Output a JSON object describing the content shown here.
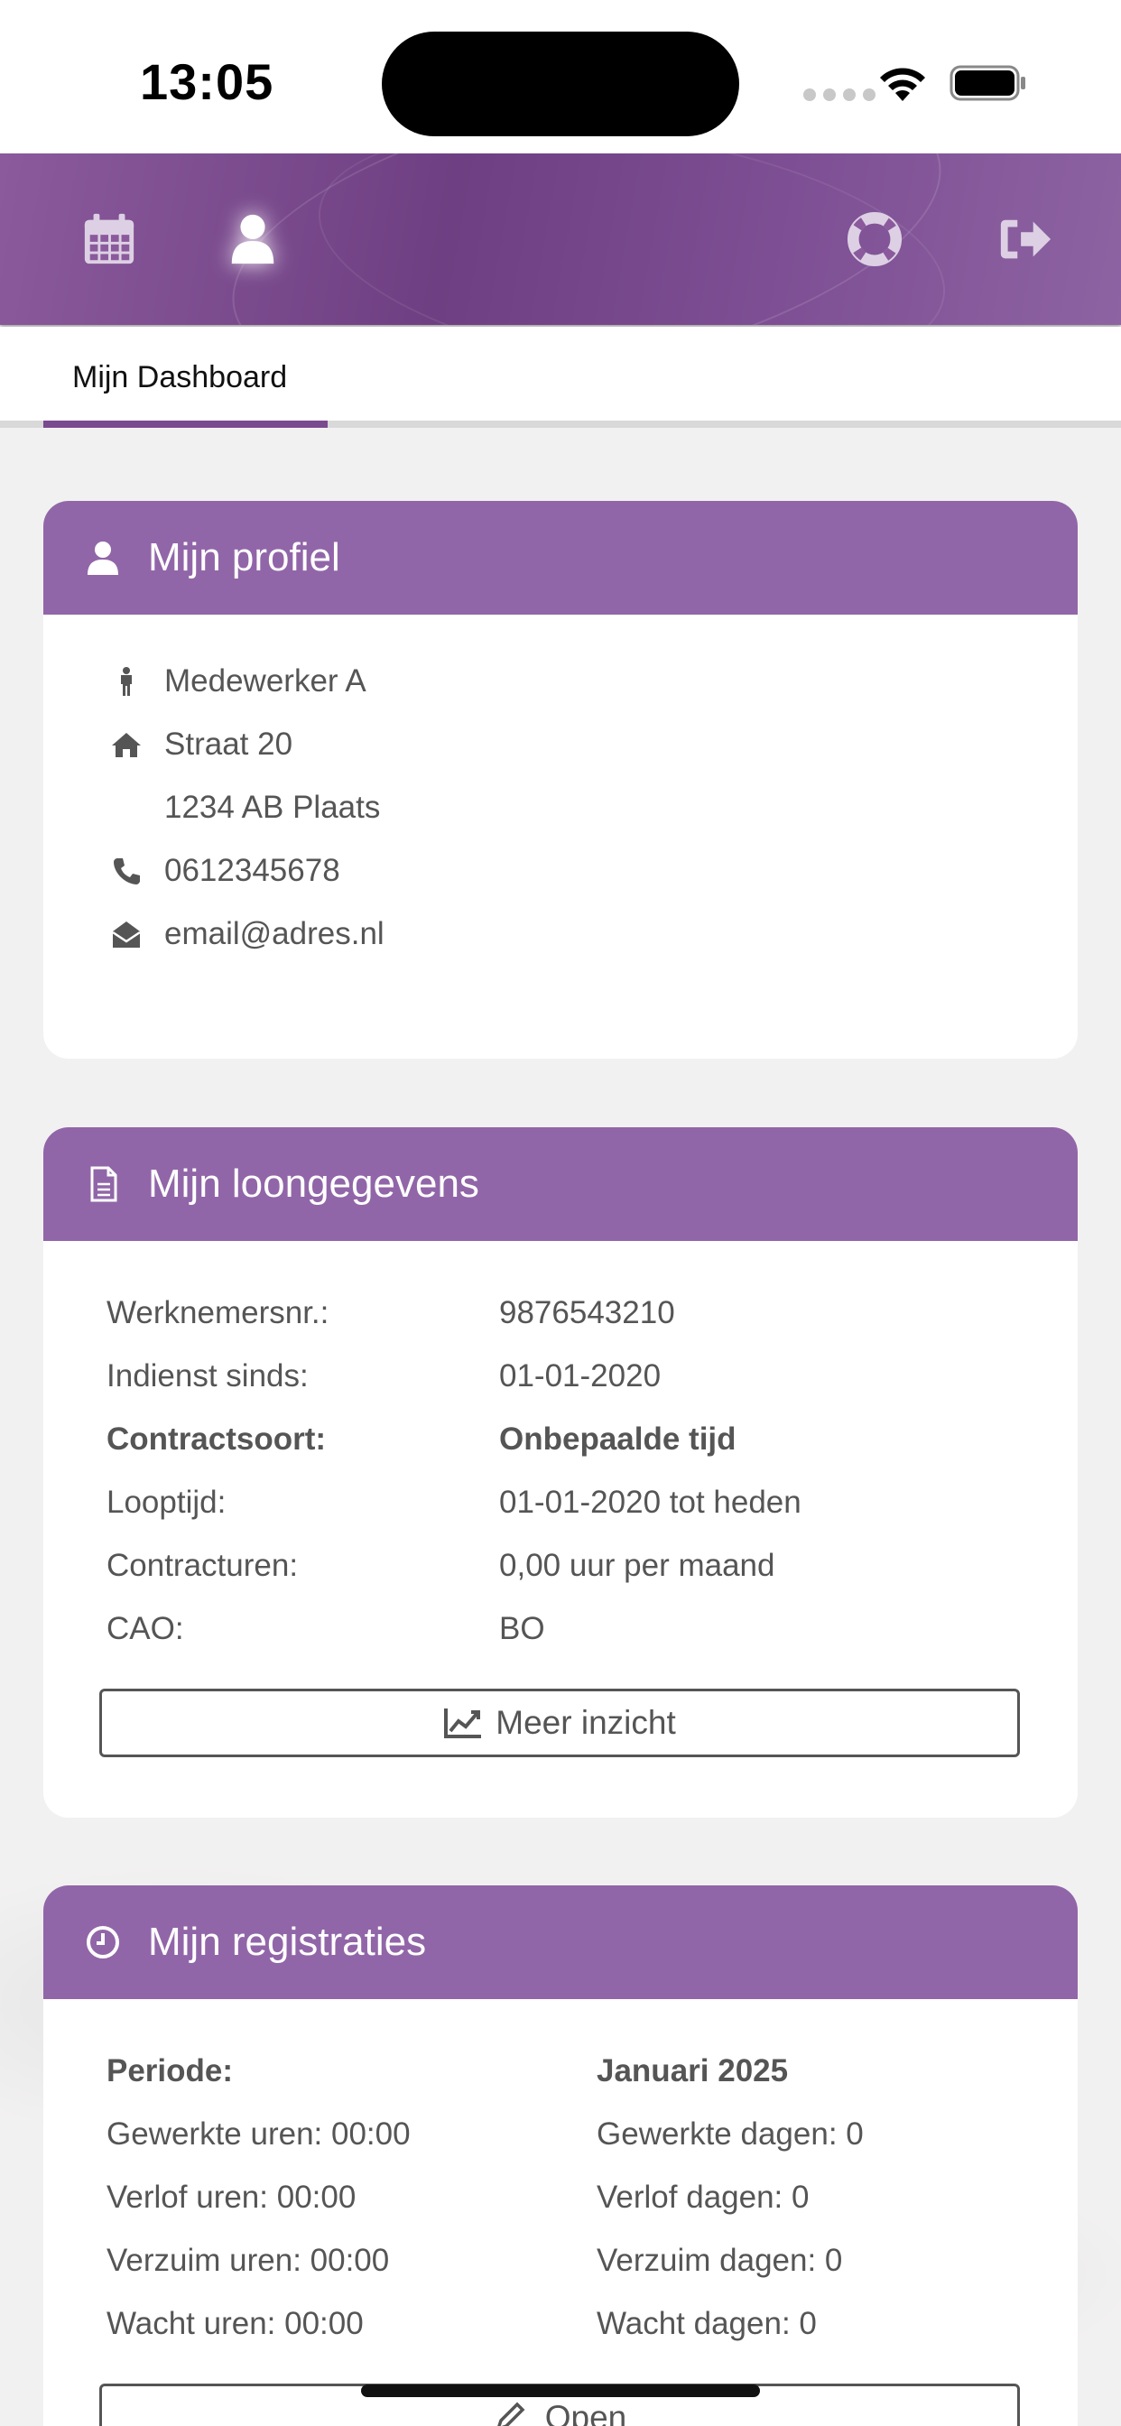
{
  "status_bar": {
    "time": "13:05"
  },
  "nav": {
    "icons": [
      "calendar-icon",
      "user-icon",
      "lifebuoy-icon",
      "sign-out-icon"
    ],
    "active": "user-icon",
    "colors": {
      "nav_purple": "#7a4a8f",
      "header_purple": "#9166a8"
    }
  },
  "tabs": {
    "active_label": "Mijn Dashboard"
  },
  "profile": {
    "title": "Mijn profiel",
    "name": "Medewerker A",
    "street": "Straat 20",
    "postal_city": "1234 AB Plaats",
    "phone": "0612345678",
    "email": "email@adres.nl"
  },
  "salary": {
    "title": "Mijn loongegevens",
    "rows": [
      {
        "label": "Werknemersnr.:",
        "value": "9876543210"
      },
      {
        "label": "Indienst sinds:",
        "value": "01-01-2020"
      },
      {
        "label": "Contractsoort:",
        "value": "Onbepaalde tijd"
      },
      {
        "label": "Looptijd:",
        "value": "01-01-2020 tot heden"
      },
      {
        "label": "Contracturen:",
        "value": "0,00 uur per maand"
      },
      {
        "label": "CAO:",
        "value": "BO"
      }
    ],
    "button_label": "Meer inzicht"
  },
  "registrations": {
    "title": "Mijn registraties",
    "period_label": "Periode:",
    "period_value": "Januari 2025",
    "left": [
      "Gewerkte uren: 00:00",
      "Verlof uren: 00:00",
      "Verzuim uren: 00:00",
      "Wacht uren: 00:00"
    ],
    "right": [
      "Gewerkte dagen: 0",
      "Verlof dagen: 0",
      "Verzuim dagen: 0",
      "Wacht dagen: 0"
    ],
    "button_label": "Open"
  }
}
